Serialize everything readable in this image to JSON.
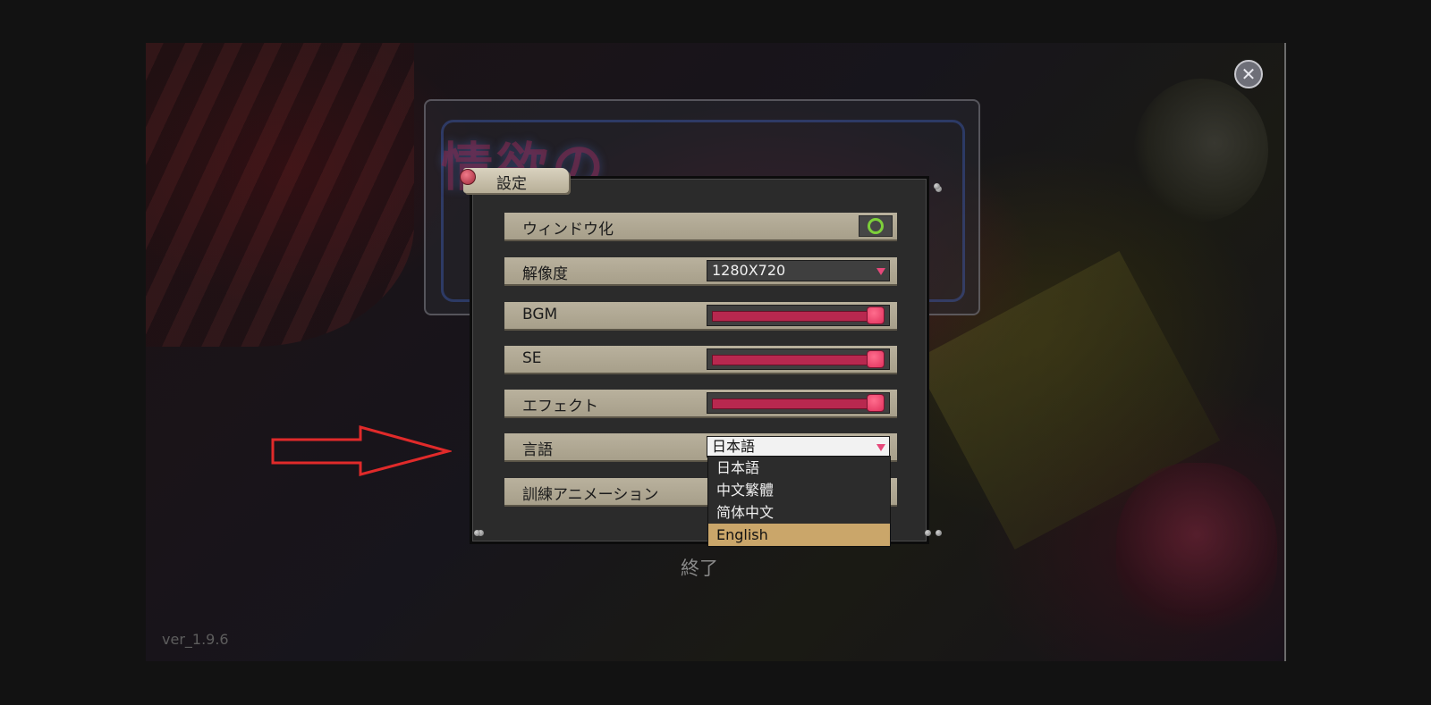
{
  "settings": {
    "tab_title": "設定",
    "rows": [
      {
        "label": "ウィンドウ化",
        "control": "toggle",
        "enabled": true
      },
      {
        "label": "解像度",
        "control": "select",
        "value": "1280X720"
      },
      {
        "label": "BGM",
        "control": "slider",
        "level": 1.0
      },
      {
        "label": "SE",
        "control": "slider",
        "level": 1.0
      },
      {
        "label": "エフェクト",
        "control": "slider",
        "level": 1.0
      },
      {
        "label": "言語",
        "control": "select",
        "value": "日本語"
      },
      {
        "label": "訓練アニメーション",
        "control": "select"
      }
    ],
    "language_options": [
      "日本語",
      "中文繁體",
      "简体中文",
      "English"
    ],
    "language_highlighted": "English"
  },
  "exit_label": "終了",
  "version": "ver_1.9.6",
  "logo_text": "情欲の",
  "colors": {
    "accent": "#e0315d",
    "slider_fill": "#b8284f",
    "toggle_on": "#7dd03a",
    "highlight": "#caa66a",
    "annotation_arrow": "#e02a2a",
    "row_bg": "#b1a994"
  },
  "icons": {
    "close": "close-icon",
    "dropdown": "chevron-down-icon",
    "annotation": "arrow-right-icon"
  }
}
